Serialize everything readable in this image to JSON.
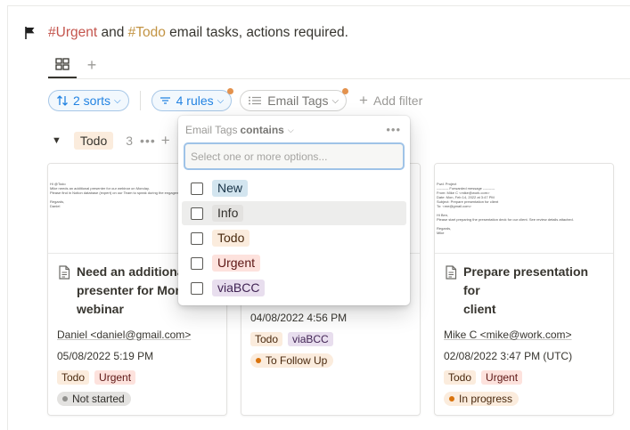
{
  "page": {
    "title_parts": {
      "urgent": "#Urgent",
      "mid": " and ",
      "todo": "#Todo",
      "rest": " email tasks, actions required."
    }
  },
  "views": {
    "add_label": "+"
  },
  "filter_bar": {
    "sorts_label": "2 sorts",
    "rules_label": "4 rules",
    "email_tags_label": "Email Tags",
    "add_filter_label": "Add filter"
  },
  "group": {
    "name": "Todo",
    "count": "3",
    "more": "•••",
    "add": "+"
  },
  "cards": [
    {
      "preview_lines": [
        "Hi @Todo",
        "Mike needs an additional presenter for our webinar on Monday.",
        "Please find in Notion database (expert) on our Team to speak during the engagement.",
        "",
        "Regards,",
        "Daniel"
      ],
      "title_lines": [
        "Need an additional",
        "presenter for Mon",
        "webinar"
      ],
      "sender": "Daniel <daniel@gmail.com>",
      "date": "05/08/2022 5:19 PM",
      "tags": [
        "Todo",
        "Urgent"
      ],
      "status": "Not started"
    },
    {
      "date": "04/08/2022 4:56 PM",
      "tags": [
        "Todo",
        "viaBCC"
      ],
      "status": "To Follow Up"
    },
    {
      "preview_lines": [
        "Fwd: Project",
        "---------- Forwarded message ----------",
        "From: Mike C <mike@work.com>",
        "Date: Mon, Feb 14, 2022 at 3:47 PM",
        "Subject: Prepare presentation for client",
        "To: <me@gmail.com>",
        "",
        "Hi Ben,",
        "Please start preparing the presentation deck for our client. See review details attached.",
        "",
        "Regards,",
        "Mike"
      ],
      "title_lines": [
        "Prepare presentation for",
        "client"
      ],
      "sender": "Mike C <mike@work.com>",
      "date": "02/08/2022 3:47 PM (UTC)",
      "tags": [
        "Todo",
        "Urgent"
      ],
      "status": "In progress"
    }
  ],
  "popup": {
    "property": "Email Tags",
    "operator": "contains",
    "more": "•••",
    "placeholder": "Select one or more options...",
    "options": [
      "New",
      "Info",
      "Todo",
      "Urgent",
      "viaBCC"
    ]
  }
}
